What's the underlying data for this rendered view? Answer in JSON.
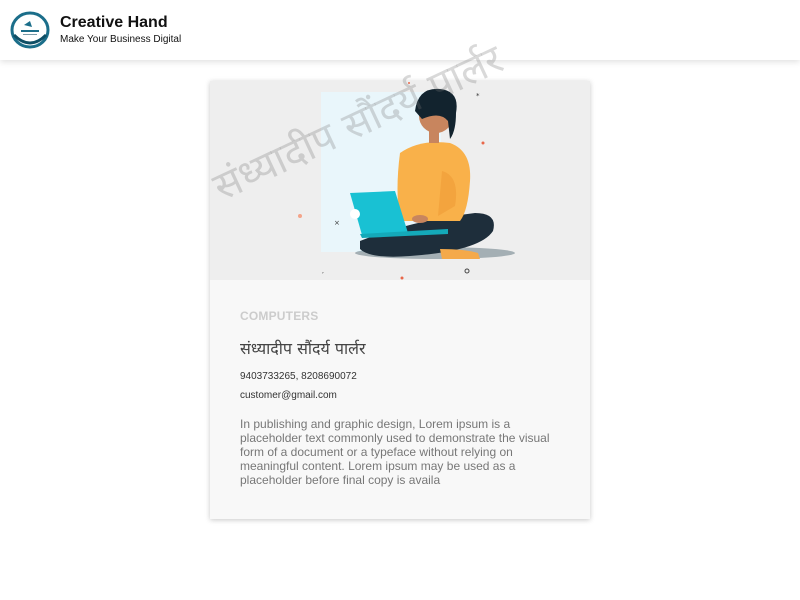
{
  "header": {
    "brand_title": "Creative Hand",
    "brand_tagline": "Make Your Business Digital",
    "logo_icon": "creative-hand-logo",
    "accent": "#1b6e8a"
  },
  "card": {
    "image_icon": "person-with-laptop-illustration",
    "category": "COMPUTERS",
    "title": "संध्यादीप सौंदर्य पार्लर",
    "phones": "9403733265, 8208690072",
    "email": "customer@gmail.com",
    "description": "In publishing and graphic design, Lorem ipsum is a placeholder text commonly used to demonstrate the visual form of a document or a typeface without relying on meaningful content. Lorem ipsum may be used as a placeholder before final copy is availa"
  },
  "watermark": "संध्यादीप सौंदर्य पार्लर"
}
